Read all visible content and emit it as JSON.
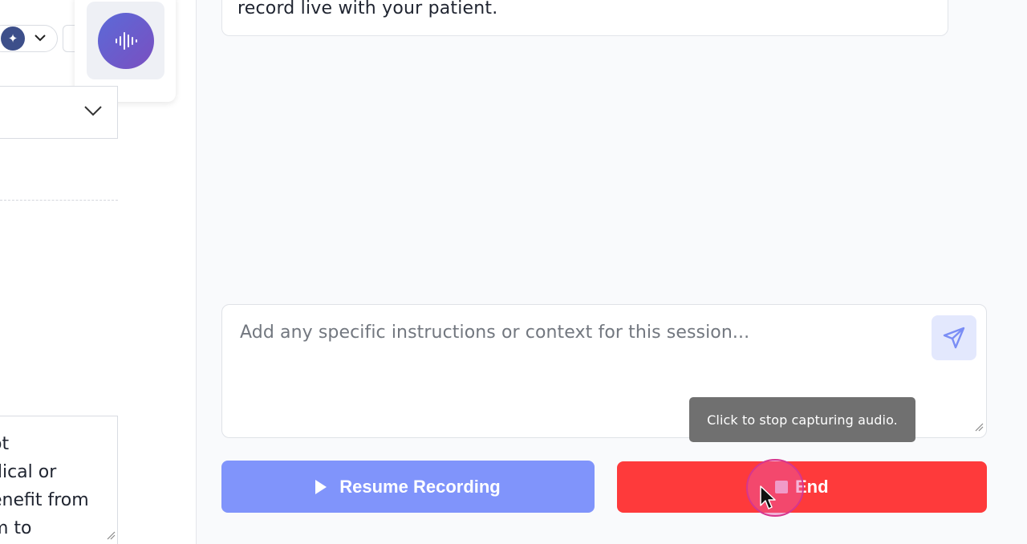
{
  "left_panel": {
    "ai_toggle_icon": "sparkle-icon",
    "chevron_icon": "chevron-down-icon",
    "mic_icon": "audio-wave-icon",
    "textarea_lines": [
      "ot",
      "dical or",
      "enefit from",
      "m to"
    ]
  },
  "main": {
    "top_card_text": "record live with your patient.",
    "instructions_placeholder": "Add any specific instructions or context for this session...",
    "send_icon": "send-icon",
    "tooltip": "Click to stop capturing audio.",
    "resume_label": "Resume Recording",
    "end_label": "End"
  },
  "colors": {
    "accent": "#8094fb",
    "danger": "#fe3a3b",
    "send_bg": "#e3e8fd",
    "tooltip_bg": "#707070"
  }
}
